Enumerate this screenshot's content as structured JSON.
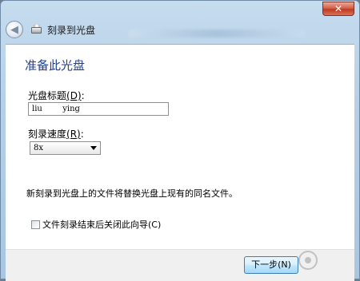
{
  "window": {
    "title": "刻录到光盘",
    "close_glyph": "✕"
  },
  "nav": {
    "back_glyph": "◀"
  },
  "page": {
    "heading": "准备此光盘",
    "disc_title_label": "光盘标题",
    "disc_title_accel": "(D)",
    "disc_title_suffix": ":",
    "disc_title_value": "liu        ying",
    "speed_label": "刻录速度",
    "speed_accel": "(R)",
    "speed_suffix": ":",
    "speed_selected": "8x",
    "replace_note": "新刻录到光盘上的文件将替换光盘上现有的同名文件。",
    "close_wizard_label": "文件刻录结束后关闭此向导",
    "close_wizard_accel": "(C)",
    "close_wizard_checked": false
  },
  "footer": {
    "next_label": "下一步(N)"
  },
  "icons": {
    "back": "back-arrow-icon",
    "title": "disc-burner-icon",
    "close": "close-icon",
    "dropdown": "chevron-down-icon"
  },
  "colors": {
    "heading": "#1f3f8f",
    "frame": "#b5cfe6",
    "next_button": "#bee6fd"
  }
}
